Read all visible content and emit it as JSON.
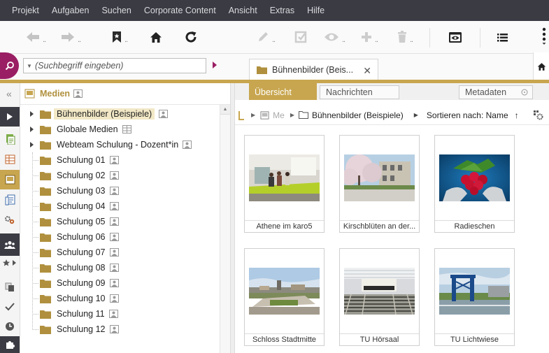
{
  "menu": [
    "Projekt",
    "Aufgaben",
    "Suchen",
    "Corporate Content",
    "Ansicht",
    "Extras",
    "Hilfe"
  ],
  "toolbar": {
    "icons": [
      "back-arrow-icon",
      "forward-arrow-icon",
      "bookmark-icon",
      "home-icon",
      "reload-icon",
      "edit-icon",
      "export-icon",
      "preview-icon",
      "add-icon",
      "delete-icon",
      "preview-window-icon",
      "list-icon",
      "more-icon"
    ],
    "dots": ".."
  },
  "search": {
    "placeholder": "(Suchbegriff eingeben)"
  },
  "tab": {
    "label": "Bühnenbilder (Beis...",
    "close": "✕"
  },
  "tree": {
    "title": "Medien",
    "items": [
      {
        "label": "Bühnenbilder (Beispiele)",
        "selected": true,
        "expandable": true
      },
      {
        "label": "Globale Medien",
        "expandable": true
      },
      {
        "label": "Webteam Schulung - Dozent*in",
        "expandable": true
      },
      {
        "label": "Schulung 01"
      },
      {
        "label": "Schulung 02"
      },
      {
        "label": "Schulung 03"
      },
      {
        "label": "Schulung 04"
      },
      {
        "label": "Schulung 05"
      },
      {
        "label": "Schulung 06"
      },
      {
        "label": "Schulung 07"
      },
      {
        "label": "Schulung 08"
      },
      {
        "label": "Schulung 09"
      },
      {
        "label": "Schulung 10"
      },
      {
        "label": "Schulung 11"
      },
      {
        "label": "Schulung 12"
      }
    ]
  },
  "subtabs": {
    "overview": "Übersicht",
    "messages": "Nachrichten",
    "metadata": "Metadaten"
  },
  "breadcrumb": {
    "root": "Me",
    "folder": "Bühnenbilder (Beispiele)",
    "sort": "Sortieren nach: Name",
    "sort_dir": "↑"
  },
  "gallery": [
    {
      "caption": "Athene im karo5"
    },
    {
      "caption": "Kirschblüten an der..."
    },
    {
      "caption": "Radieschen"
    },
    {
      "caption": "Schloss Stadtmitte"
    },
    {
      "caption": "TU Hörsaal"
    },
    {
      "caption": "TU Lichtwiese"
    }
  ],
  "colors": {
    "menubar": "#3b3b44",
    "accent": "#c8a64f",
    "search": "#9a1e63"
  }
}
